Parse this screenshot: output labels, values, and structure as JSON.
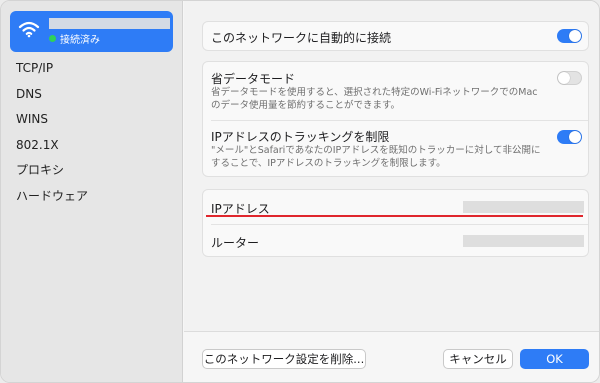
{
  "sidebar": {
    "selected": {
      "icon": "wifi-icon",
      "status": "接続済み",
      "status_color": "#2fd158"
    },
    "items": [
      {
        "label": "TCP/IP"
      },
      {
        "label": "DNS"
      },
      {
        "label": "WINS"
      },
      {
        "label": "802.1X"
      },
      {
        "label": "プロキシ"
      },
      {
        "label": "ハードウェア"
      }
    ]
  },
  "settings": {
    "auto_join": {
      "label": "このネットワークに自動的に接続",
      "enabled": true
    },
    "low_data": {
      "label": "省データモード",
      "description": "省データモードを使用すると、選択された特定のWi-FiネットワークでのMacのデータ使用量を節約することができます。",
      "enabled": false
    },
    "ip_tracking": {
      "label": "IPアドレスのトラッキングを制限",
      "description": "\"メール\"とSafariであなたのIPアドレスを既知のトラッカーに対して非公開にすることで、IPアドレスのトラッキングを制限します。",
      "enabled": true
    },
    "ip_address": {
      "label": "IPアドレス"
    },
    "router": {
      "label": "ルーター"
    }
  },
  "footer": {
    "forget_label": "このネットワーク設定を削除...",
    "cancel_label": "キャンセル",
    "ok_label": "OK"
  },
  "colors": {
    "accent": "#2e7cf6",
    "highlight_underline": "#e0262d"
  }
}
